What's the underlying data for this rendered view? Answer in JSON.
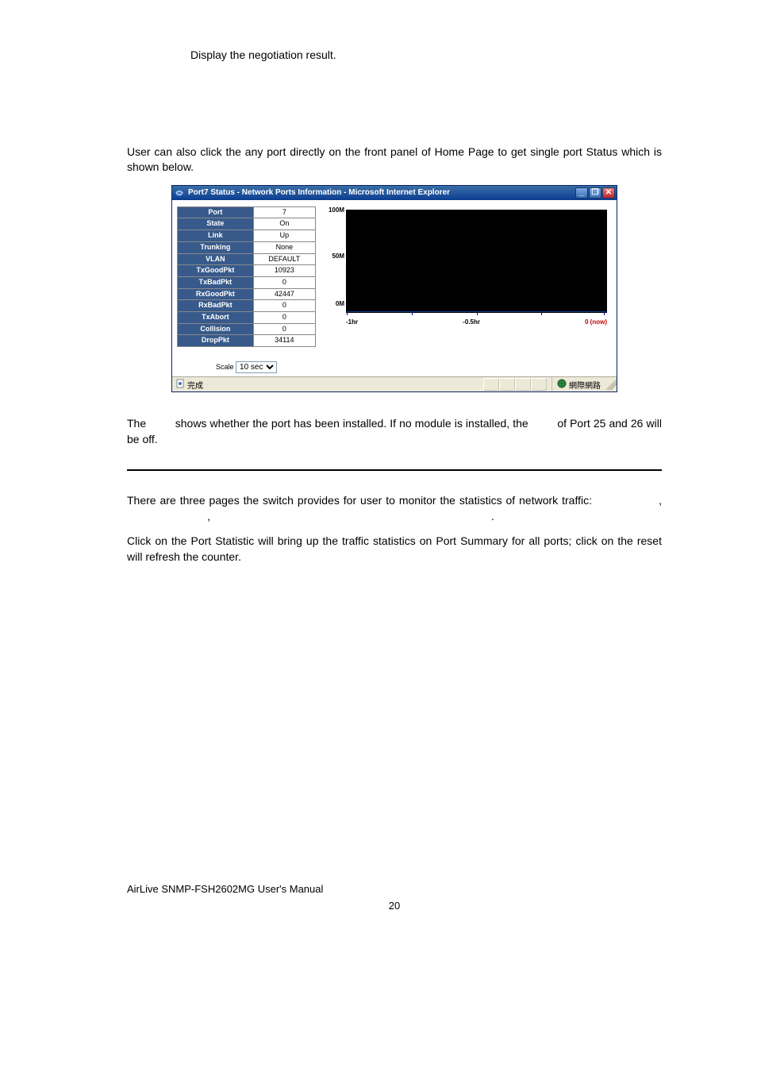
{
  "paragraphs": {
    "p1": "Display the negotiation result.",
    "p2": "User can also click the any port directly on the front panel of Home Page to get single port Status which is shown below.",
    "p3_a": "The",
    "p3_b": "shows whether the port has been installed.  If no module is installed, the",
    "p3_c": "of Port 25 and 26 will be off.",
    "p4": "There are three pages the switch provides for user to monitor the statistics of network traffic:",
    "p4_punct_1": ",",
    "p4_punct_2": ",",
    "p4_punct_3": ".",
    "p5": "Click on the Port Statistic will bring up the traffic statistics  on Port Summary for all ports; click on the reset will refresh the counter."
  },
  "window": {
    "title": "Port7 Status - Network Ports Information - Microsoft Internet Explorer",
    "min": "_",
    "max": "❐",
    "close": "✕",
    "stats": [
      {
        "label": "Port",
        "value": "7"
      },
      {
        "label": "State",
        "value": "On"
      },
      {
        "label": "Link",
        "value": "Up"
      },
      {
        "label": "Trunking",
        "value": "None"
      },
      {
        "label": "VLAN",
        "value": "DEFAULT"
      },
      {
        "label": "TxGoodPkt",
        "value": "10923"
      },
      {
        "label": "TxBadPkt",
        "value": "0"
      },
      {
        "label": "RxGoodPkt",
        "value": "42447"
      },
      {
        "label": "RxBadPkt",
        "value": "0"
      },
      {
        "label": "TxAbort",
        "value": "0"
      },
      {
        "label": "Collision",
        "value": "0"
      },
      {
        "label": "DropPkt",
        "value": "34114"
      }
    ],
    "scale_label": "Scale",
    "scale_value": "10 sec",
    "yticks": {
      "top": "100M",
      "mid": "50M",
      "bot": "0M"
    },
    "xticks": {
      "left": "-1hr",
      "mid": "-0.5hr",
      "right": "0 (now)"
    },
    "status_done": "完成",
    "status_net": "網際網路"
  },
  "chart_data": {
    "type": "line",
    "title": "",
    "xlabel": "",
    "ylabel": "",
    "ylim": [
      0,
      100
    ],
    "x_unit": "hr",
    "y_unit": "M",
    "categories": [
      "-1hr",
      "-0.5hr",
      "0 (now)"
    ],
    "values": [
      0,
      0,
      0
    ]
  },
  "footer": {
    "manual": "AirLive SNMP-FSH2602MG User's Manual",
    "page": "20"
  }
}
